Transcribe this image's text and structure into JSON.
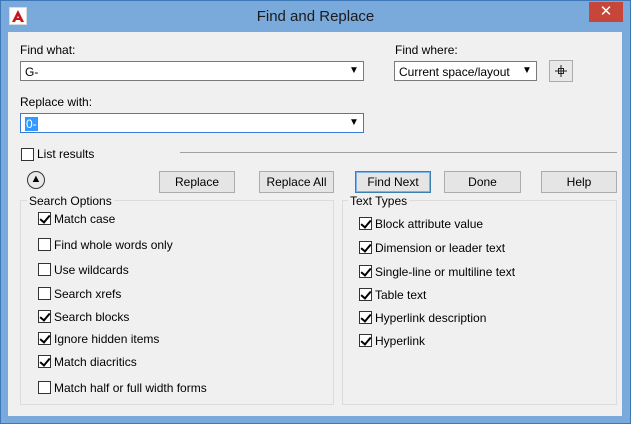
{
  "window": {
    "title": "Find and Replace",
    "close_glyph": "✕"
  },
  "find_what": {
    "label": "Find what:",
    "value": "G-"
  },
  "find_where": {
    "label": "Find where:",
    "value": "Current space/layout"
  },
  "replace_with": {
    "label": "Replace with:",
    "value": "0-"
  },
  "list_results": {
    "label": "List results",
    "checked": false
  },
  "buttons": {
    "replace": "Replace",
    "replace_all": "Replace All",
    "find_next": "Find Next",
    "done": "Done",
    "help": "Help"
  },
  "search_options": {
    "title": "Search Options",
    "items": [
      {
        "label": "Match case",
        "checked": true
      },
      {
        "label": "Find whole words only",
        "checked": false
      },
      {
        "label": "Use wildcards",
        "checked": false
      },
      {
        "label": "Search xrefs",
        "checked": false
      },
      {
        "label": "Search blocks",
        "checked": true
      },
      {
        "label": "Ignore hidden items",
        "checked": true
      },
      {
        "label": "Match diacritics",
        "checked": true
      },
      {
        "label": "Match half or full width forms",
        "checked": false
      }
    ]
  },
  "text_types": {
    "title": "Text Types",
    "items": [
      {
        "label": "Block attribute value",
        "checked": true
      },
      {
        "label": "Dimension or leader text",
        "checked": true
      },
      {
        "label": "Single-line or multiline text",
        "checked": true
      },
      {
        "label": "Table text",
        "checked": true
      },
      {
        "label": "Hyperlink description",
        "checked": true
      },
      {
        "label": "Hyperlink",
        "checked": true
      }
    ]
  },
  "icons": {
    "app": "autocad-icon",
    "collapse": "collapse-up-icon",
    "pick": "select-objects-icon",
    "dropdown": "chevron-down-icon"
  },
  "colors": {
    "titlebar": "#7aa9db",
    "close": "#c7463a",
    "selection": "#3399ff"
  }
}
